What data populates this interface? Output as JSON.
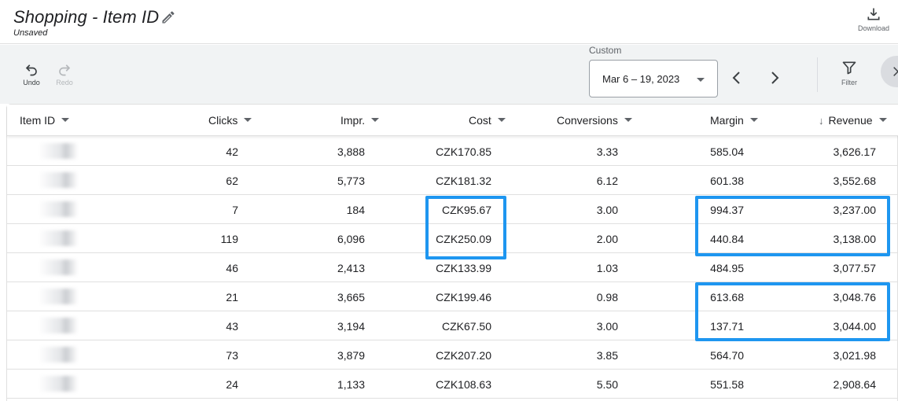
{
  "header": {
    "title": "Shopping - Item ID",
    "subtitle": "Unsaved",
    "download_label": "Download"
  },
  "toolbar": {
    "undo_label": "Undo",
    "redo_label": "Redo",
    "date_type_label": "Custom",
    "date_range": "Mar 6 – 19, 2023",
    "filter_label": "Filter"
  },
  "table": {
    "columns": {
      "item_id": "Item ID",
      "clicks": "Clicks",
      "impr": "Impr.",
      "cost": "Cost",
      "conversions": "Conversions",
      "margin": "Margin",
      "revenue": "Revenue"
    },
    "rows": [
      {
        "clicks": "42",
        "impr": "3,888",
        "cost": "CZK170.85",
        "conversions": "3.33",
        "margin": "585.04",
        "revenue": "3,626.17"
      },
      {
        "clicks": "62",
        "impr": "5,773",
        "cost": "CZK181.32",
        "conversions": "6.12",
        "margin": "601.38",
        "revenue": "3,552.68"
      },
      {
        "clicks": "7",
        "impr": "184",
        "cost": "CZK95.67",
        "conversions": "3.00",
        "margin": "994.37",
        "revenue": "3,237.00"
      },
      {
        "clicks": "119",
        "impr": "6,096",
        "cost": "CZK250.09",
        "conversions": "2.00",
        "margin": "440.84",
        "revenue": "3,138.00"
      },
      {
        "clicks": "46",
        "impr": "2,413",
        "cost": "CZK133.99",
        "conversions": "1.03",
        "margin": "484.95",
        "revenue": "3,077.57"
      },
      {
        "clicks": "21",
        "impr": "3,665",
        "cost": "CZK199.46",
        "conversions": "0.98",
        "margin": "613.68",
        "revenue": "3,048.76"
      },
      {
        "clicks": "43",
        "impr": "3,194",
        "cost": "CZK67.50",
        "conversions": "3.00",
        "margin": "137.71",
        "revenue": "3,044.00"
      },
      {
        "clicks": "73",
        "impr": "3,879",
        "cost": "CZK207.20",
        "conversions": "3.85",
        "margin": "564.70",
        "revenue": "3,021.98"
      },
      {
        "clicks": "24",
        "impr": "1,133",
        "cost": "CZK108.63",
        "conversions": "5.50",
        "margin": "551.58",
        "revenue": "2,908.64"
      }
    ]
  },
  "colors": {
    "highlight": "#1e96f0",
    "toolbar_bg": "#f1f3f4"
  },
  "icons": [
    "edit-pencil-icon",
    "download-icon",
    "undo-icon",
    "redo-icon",
    "chevron-left-icon",
    "chevron-right-icon",
    "filter-icon",
    "collapse-icon"
  ]
}
